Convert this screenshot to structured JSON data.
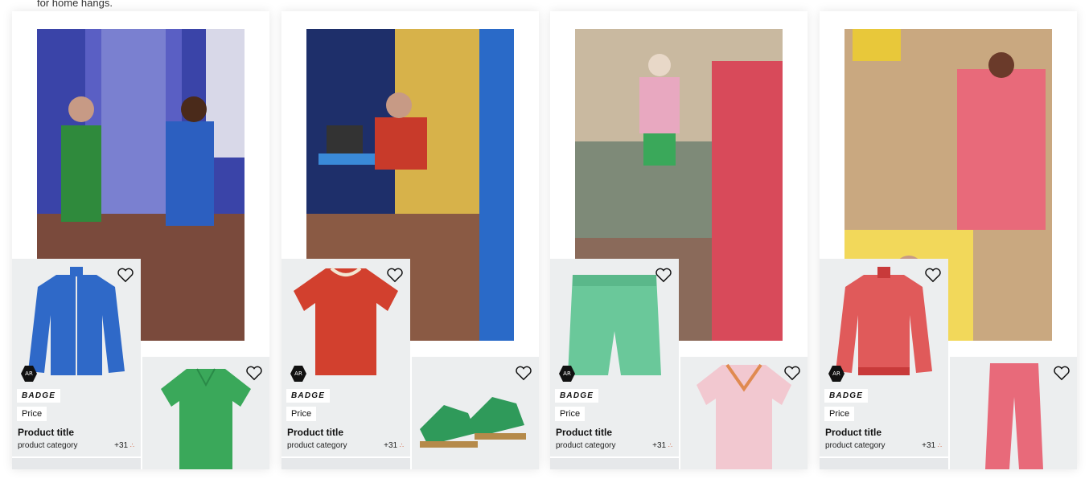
{
  "top_text": "for home hangs.",
  "columns": [
    {
      "name": "look-1",
      "product": {
        "badge": "BADGE",
        "price": "Price",
        "title": "Product title",
        "category": "product category",
        "colors": "+31",
        "ar": "AR",
        "art": "blue-track-jacket"
      },
      "side_product": {
        "art": "green-polo-shirt"
      }
    },
    {
      "name": "look-2",
      "product": {
        "badge": "BADGE",
        "price": "Price",
        "title": "Product title",
        "category": "product category",
        "colors": "+31",
        "ar": "AR",
        "art": "red-tshirt"
      },
      "side_product": {
        "art": "green-sneakers"
      }
    },
    {
      "name": "look-3",
      "product": {
        "badge": "BADGE",
        "price": "Price",
        "title": "Product title",
        "category": "product category",
        "colors": "+31",
        "ar": "AR",
        "art": "green-shorts"
      },
      "side_product": {
        "art": "pink-vneck-tee"
      }
    },
    {
      "name": "look-4",
      "product": {
        "badge": "BADGE",
        "price": "Price",
        "title": "Product title",
        "category": "product category",
        "colors": "+31",
        "ar": "AR",
        "art": "red-pattern-jacket"
      },
      "side_product": {
        "art": "red-pattern-pants"
      }
    }
  ],
  "colors": {
    "card_bg": "#eceeef",
    "badge_bg": "#ffffff",
    "text": "#111111"
  }
}
